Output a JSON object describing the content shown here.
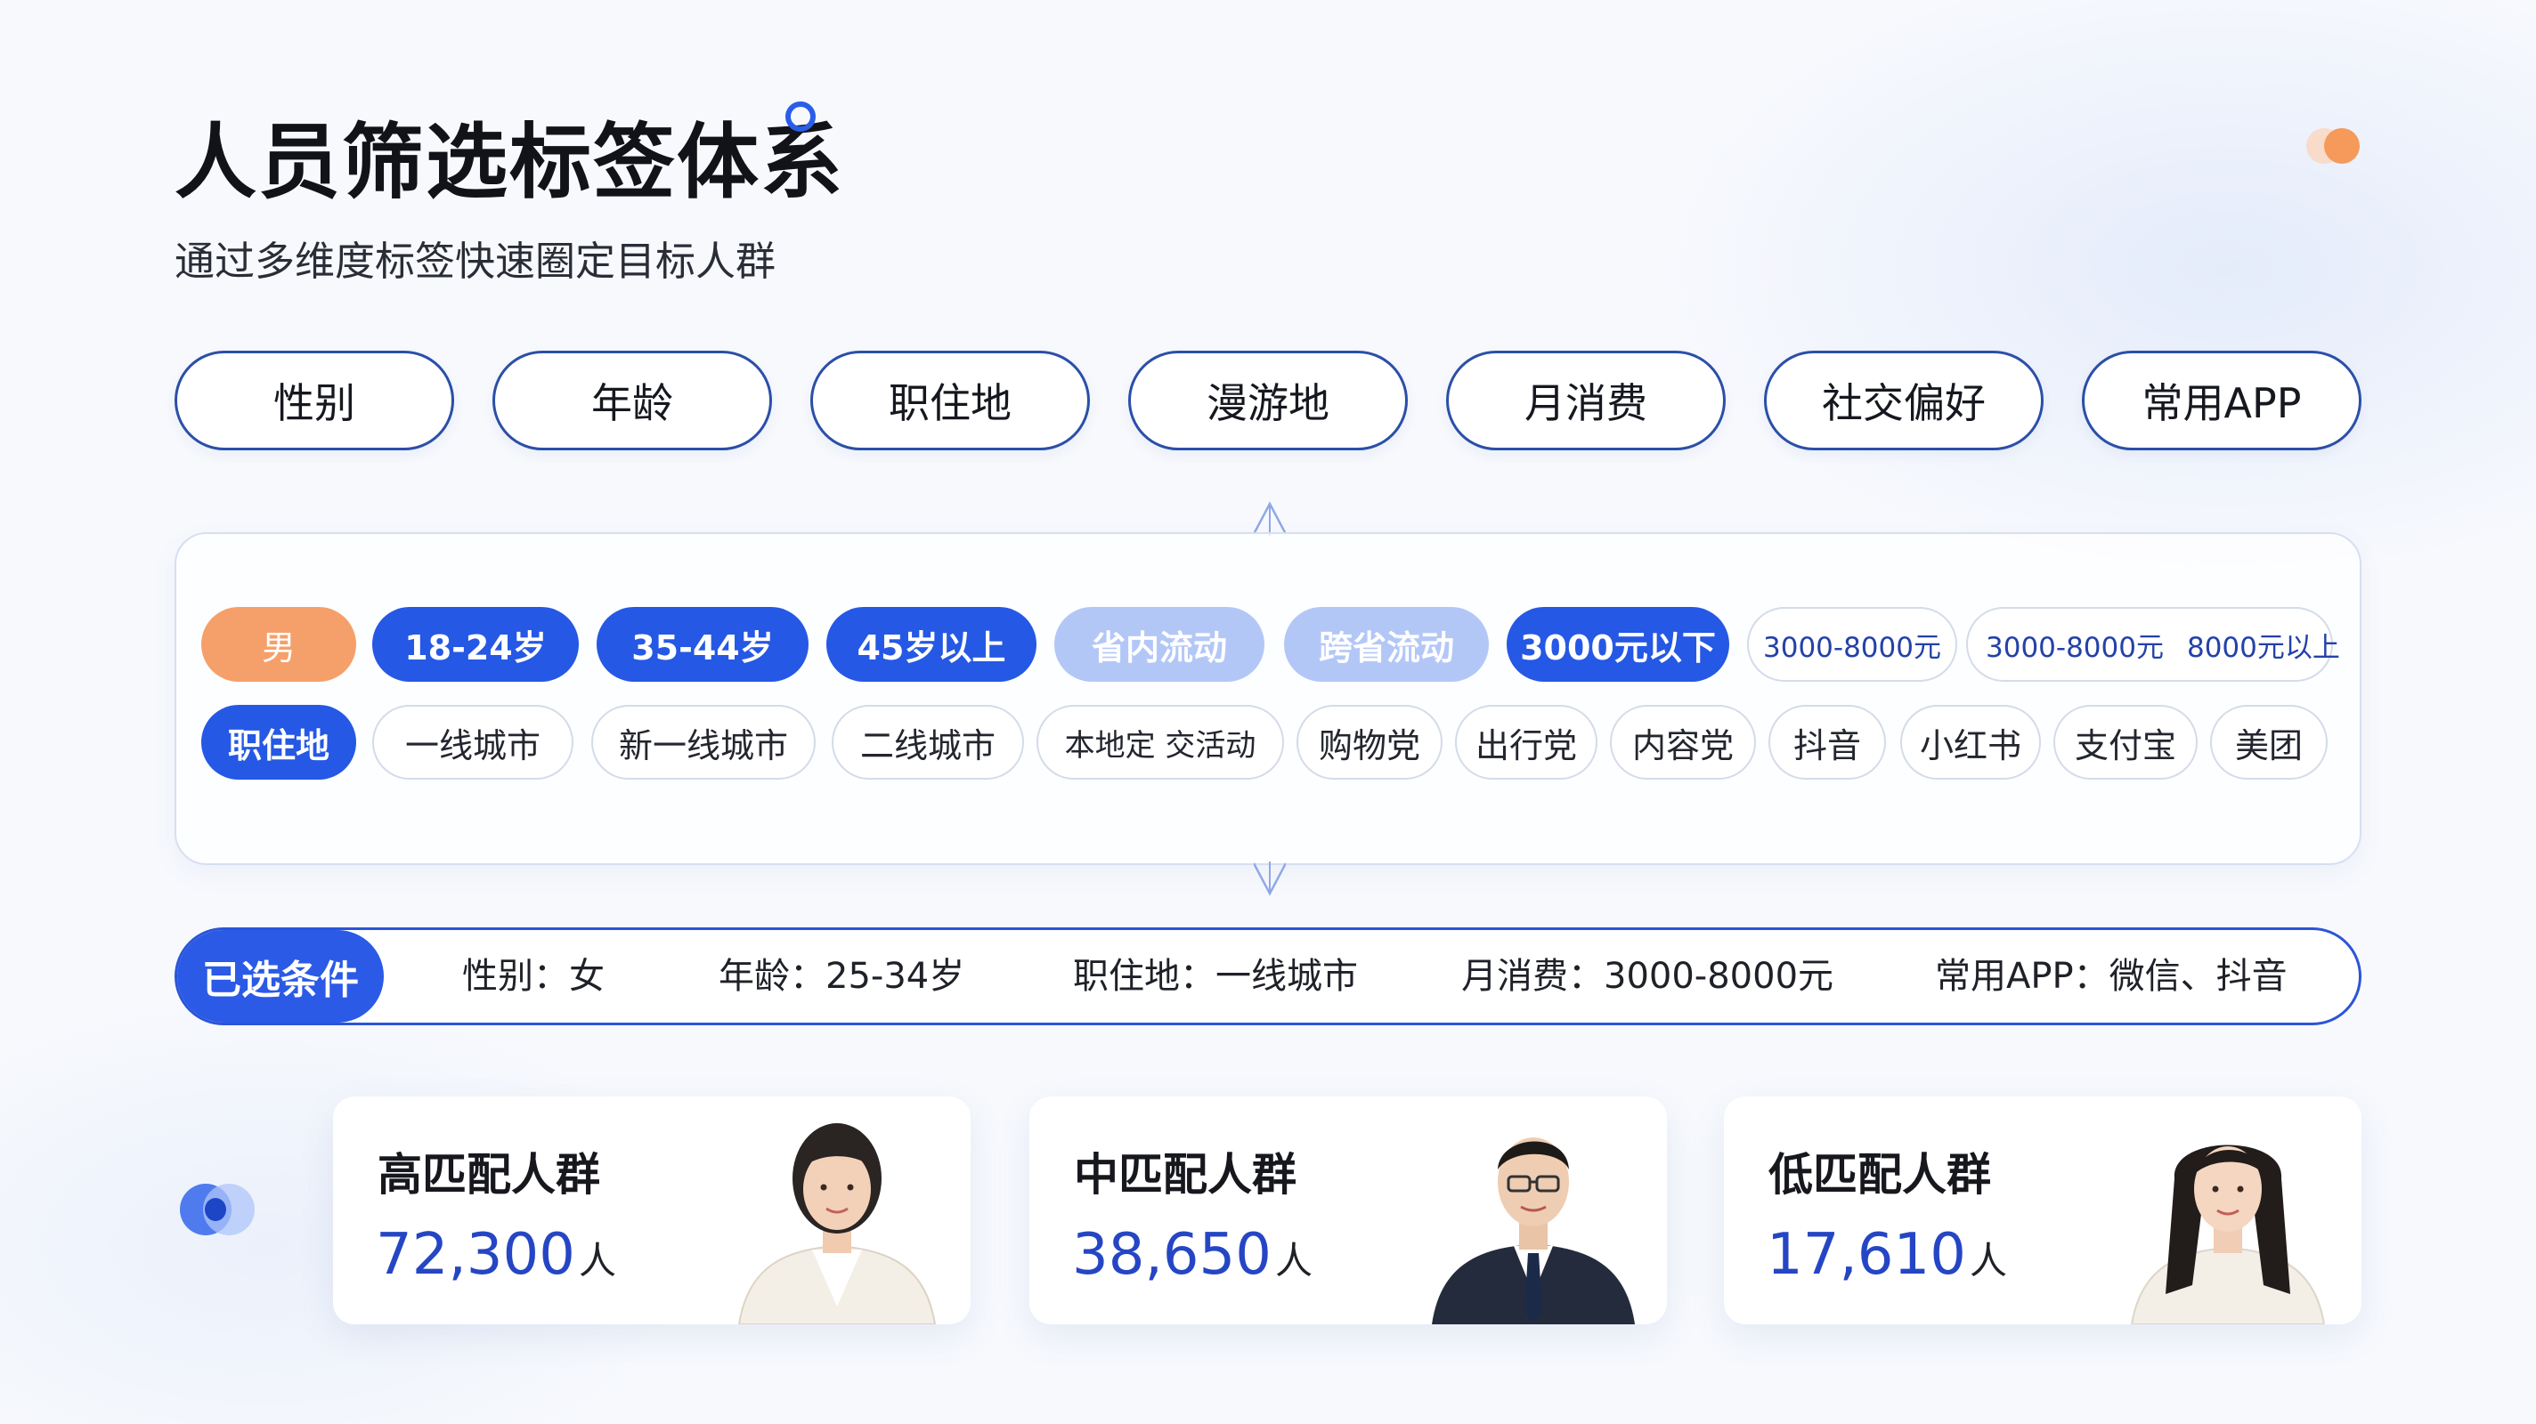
{
  "header": {
    "title": "人员筛选标签体系",
    "subtitle": "通过多维度标签快速圈定目标人群"
  },
  "categories": [
    {
      "label": "性别"
    },
    {
      "label": "年龄"
    },
    {
      "label": "职住地"
    },
    {
      "label": "漫游地"
    },
    {
      "label": "月消费"
    },
    {
      "label": "社交偏好"
    },
    {
      "label": "常用APP"
    }
  ],
  "tags": {
    "row1": [
      {
        "label": "男",
        "style": "orange"
      },
      {
        "label": "18-24岁",
        "style": "blue"
      },
      {
        "label": "35-44岁",
        "style": "blue"
      },
      {
        "label": "45岁以上",
        "style": "blue"
      },
      {
        "label": "省内流动",
        "style": "light"
      },
      {
        "label": "跨省流动",
        "style": "light"
      },
      {
        "label": "3000元以下",
        "style": "blue"
      },
      {
        "label": "3000-8000元",
        "style": "outline-blue"
      },
      {
        "label": "3000-8000元",
        "style": "outline-blue"
      },
      {
        "label": "8000元以上",
        "style": "outline-blue"
      }
    ],
    "row2": [
      {
        "label": "职住地",
        "style": "blue"
      },
      {
        "label": "一线城市",
        "style": "outline"
      },
      {
        "label": "新一线城市",
        "style": "outline"
      },
      {
        "label": "二线城市",
        "style": "outline"
      },
      {
        "label": "本地定 交活�much",
        "style": "outline"
      },
      {
        "label": "购物党",
        "style": "outline"
      },
      {
        "label": "出行党",
        "style": "outline"
      },
      {
        "label": "内容党",
        "style": "outline"
      },
      {
        "label": "抖音",
        "style": "outline"
      },
      {
        "label": "小红书",
        "style": "outline"
      },
      {
        "label": "支付宝",
        "style": "outline"
      },
      {
        "label": "美团",
        "style": "outline"
      }
    ]
  },
  "selected": {
    "label": "已选条件",
    "items": [
      {
        "text": "性别：女"
      },
      {
        "text": "年龄：25-34岁"
      },
      {
        "text": "职住地：一线城市"
      },
      {
        "text": "月消费：3000-8000元"
      },
      {
        "text": "常用APP：微信、抖音"
      }
    ]
  },
  "cards": [
    {
      "title": "高匹配人群",
      "count": "72,300",
      "unit": "人"
    },
    {
      "title": "中匹配人群",
      "count": "38,650",
      "unit": "人"
    },
    {
      "title": "低匹配人群",
      "count": "17,610",
      "unit": "人"
    }
  ],
  "colors": {
    "primary": "#2558e4",
    "light_blue": "#b3c7f7",
    "orange": "#f5a06a",
    "outline": "#2b4fa8",
    "number": "#2546c4"
  }
}
